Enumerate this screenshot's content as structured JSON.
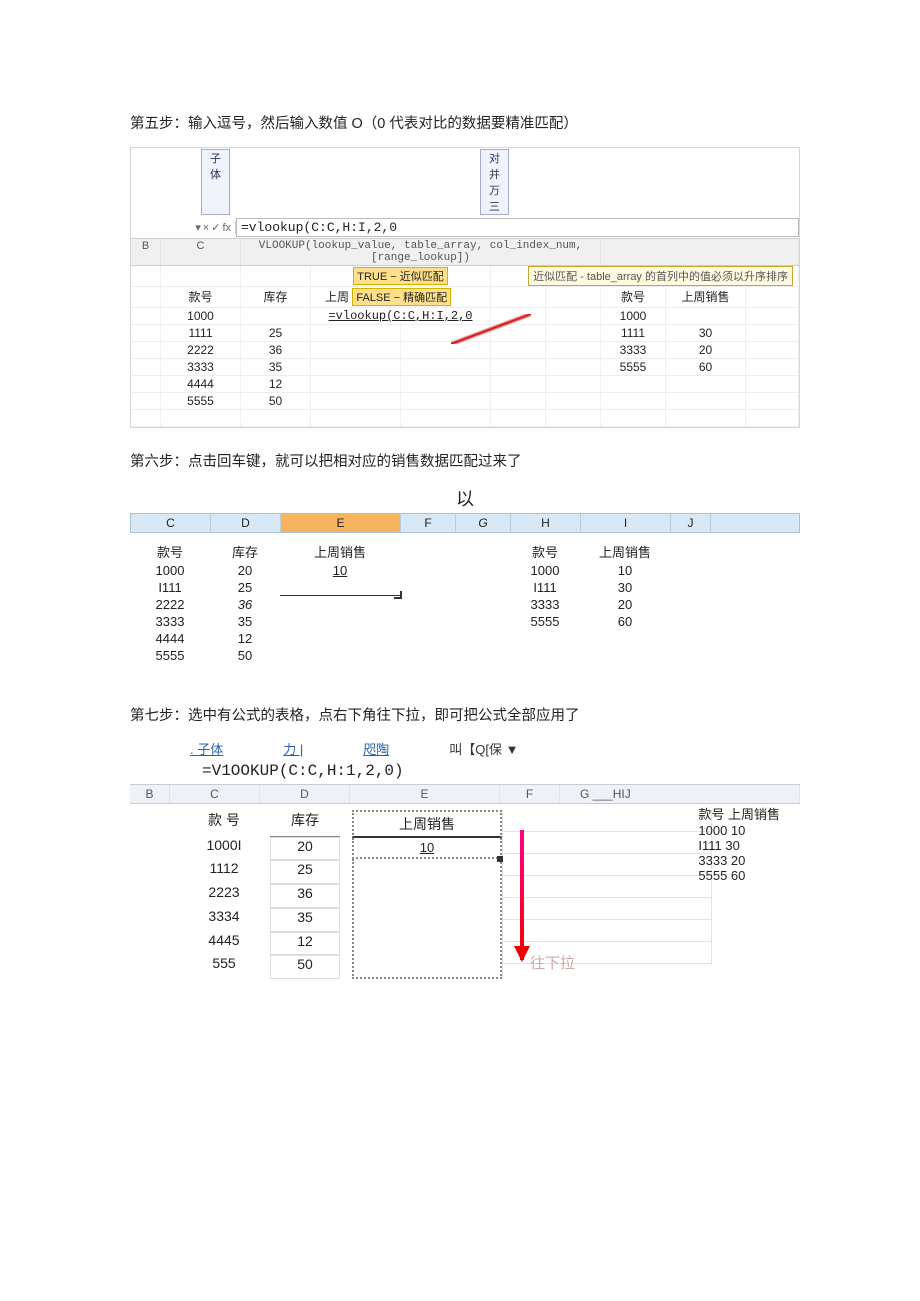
{
  "step5": {
    "title": "第五步：输入逗号，然后输入数值 O（0 代表对比的数据要精准匹配）",
    "tab_font": "子体",
    "tab_merge": "对并万三",
    "fb_cancel": "×",
    "fb_enter": "✓",
    "fb_fx": "fx",
    "fb_dropdown": "▾",
    "formula": "=vlookup(C:C,H:I,2,0",
    "sig": "VLOOKUP(lookup_value, table_array, col_index_num, [range_lookup])",
    "hint_true": "TRUE − 近似匹配",
    "hint_false": "FALSE − 精确匹配",
    "tip": "近似匹配 - table_array 的首列中的值必须以升序排序",
    "col_B": "B",
    "col_C": "C",
    "hdr_kh": "款号",
    "hdr_kc": "库存",
    "hdr_sz": "上周",
    "mid_formula": "=vlookup(C:C,H:I,2,0",
    "hdr2_kh": "款号",
    "hdr2_sz": "上周销售",
    "rows_left": [
      {
        "c": "1000",
        "d": ""
      },
      {
        "c": "1111",
        "d": "25"
      },
      {
        "c": "2222",
        "d": "36"
      },
      {
        "c": "3333",
        "d": "35"
      },
      {
        "c": "4444",
        "d": "12"
      },
      {
        "c": "5555",
        "d": "50"
      }
    ],
    "rows_right": [
      {
        "h": "1000",
        "i": ""
      },
      {
        "h": "1111",
        "i": "30"
      },
      {
        "h": "3333",
        "i": "20"
      },
      {
        "h": "5555",
        "i": "60"
      }
    ]
  },
  "step6": {
    "title": "第六步：点击回车键，就可以把相对应的销售数据匹配过来了",
    "head": "以",
    "cols": {
      "C": "C",
      "D": "D",
      "E": "E",
      "F": "F",
      "G": "G",
      "H": "H",
      "I": "I",
      "J": "J"
    },
    "hdr_kh": "款号",
    "hdr_kc": "库存",
    "hdr_sz": "上周销售",
    "hdr2_kh": "款号",
    "hdr2_sz": "上周销售",
    "left": [
      {
        "c": "1000",
        "d": "20",
        "e": "10"
      },
      {
        "c": "I111",
        "d": "25",
        "e": ""
      },
      {
        "c": "2222",
        "d": "36",
        "e": ""
      },
      {
        "c": "3333",
        "d": "35",
        "e": ""
      },
      {
        "c": "4444",
        "d": "12",
        "e": ""
      },
      {
        "c": "5555",
        "d": "50",
        "e": ""
      }
    ],
    "right": [
      {
        "h": "1000",
        "i": "10"
      },
      {
        "h": "I111",
        "i": "30"
      },
      {
        "h": "3333",
        "i": "20"
      },
      {
        "h": "5555",
        "i": "60"
      }
    ]
  },
  "step7": {
    "title": "第七步：选中有公式的表格，点右下角往下拉，即可把公式全部应用了",
    "tabs": {
      "a": ". 子体",
      "b": "力 |",
      "c": "咫陶",
      "d": "叫【Q[保 ▼"
    },
    "formula": "=V1OOKUP(C:C,H:1,2,0)",
    "cols": {
      "B": "B",
      "C": "C",
      "D": "D",
      "E": "E",
      "F": "F",
      "rest": "G ___HIJ"
    },
    "hdr_kh": "款 号",
    "hdr_kc": "库存",
    "hdr_sz": "上周销售",
    "cell10": "10",
    "left": [
      {
        "c": "1000I",
        "d": "20"
      },
      {
        "c": "1112",
        "d": "25"
      },
      {
        "c": "2223",
        "d": "36"
      },
      {
        "c": "3334",
        "d": "35"
      },
      {
        "c": "4445",
        "d": "12"
      },
      {
        "c": "555",
        "d": "50"
      }
    ],
    "hdr2": "款号  上周销售",
    "right": [
      {
        "t": "1000 10"
      },
      {
        "t": "I111  30"
      },
      {
        "t": "3333 20"
      },
      {
        "t": "5555 60"
      }
    ],
    "drag_label": "往下拉"
  }
}
